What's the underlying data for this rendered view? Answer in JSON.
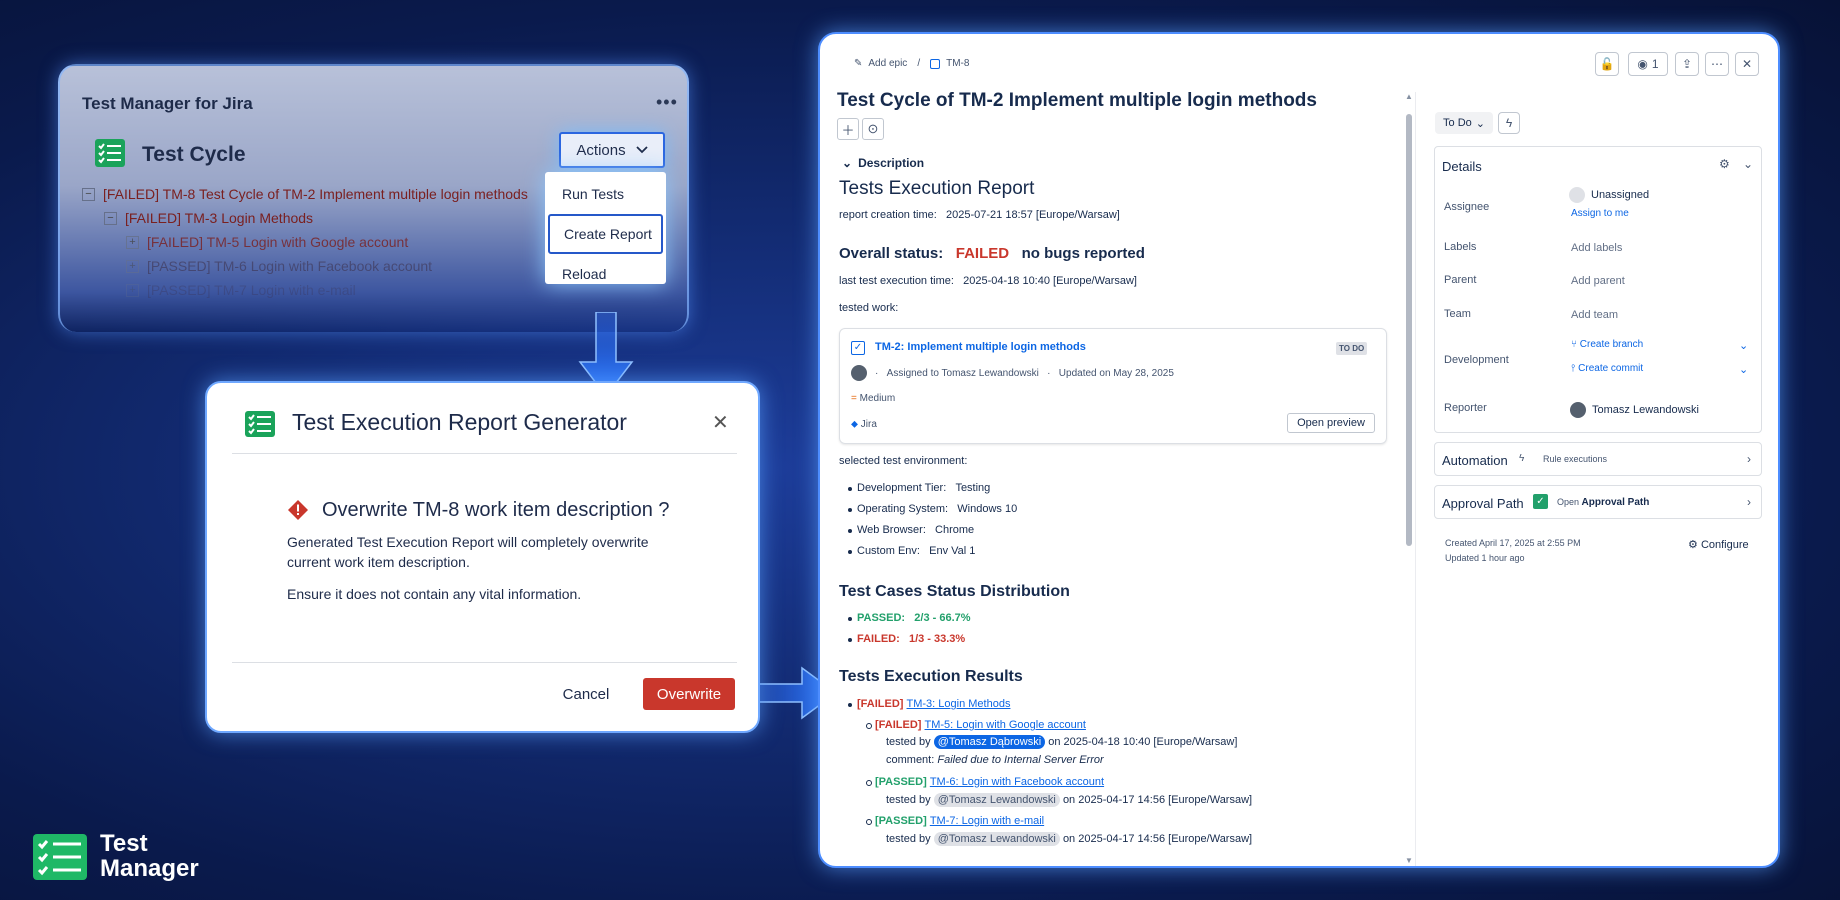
{
  "colors": {
    "accent": "#0c66e4",
    "danger": "#c9372c",
    "success": "#22a06b",
    "background": "#122a70",
    "glow": "#4d8dff"
  },
  "plugin": {
    "title": "Test Manager for Jira",
    "more_icon": "more-horizontal-icon",
    "section_title": "Test Cycle",
    "actions_label": "Actions",
    "menu": [
      "Run Tests",
      "Create Report",
      "Reload"
    ],
    "tree": [
      {
        "text": "[FAILED] TM-8 Test Cycle of TM-2 Implement multiple login methods",
        "toggle": "−"
      },
      {
        "text": "[FAILED] TM-3 Login Methods",
        "toggle": "−"
      },
      {
        "text": "[FAILED] TM-5 Login with Google account",
        "toggle": "+"
      },
      {
        "text": "[PASSED] TM-6 Login with Facebook account",
        "toggle": "+"
      },
      {
        "text": "[PASSED] TM-7 Login with e-mail",
        "toggle": "+"
      }
    ]
  },
  "dialog": {
    "title": "Test Execution Report Generator",
    "heading": "Overwrite TM-8 work item description ?",
    "body1": "Generated Test Execution Report will completely overwrite current work item description.",
    "body2": "Ensure it does not contain any vital information.",
    "cancel": "Cancel",
    "confirm": "Overwrite"
  },
  "brand": {
    "line1": "Test",
    "line2": "Manager"
  },
  "jira": {
    "breadcrumb": {
      "epic": "Add epic",
      "separator": "/",
      "key": "TM-8"
    },
    "watchers": "1",
    "title": "Test Cycle of TM-2 Implement multiple login methods",
    "description_label": "Description",
    "report": {
      "title": "Tests Execution Report",
      "creation_label": "report creation time:",
      "creation_time": "2025-07-21 18:57 [Europe/Warsaw]",
      "overall_label": "Overall status:",
      "overall_status": "FAILED",
      "bugs": "no bugs reported",
      "last_exec_label": "last test execution time:",
      "last_exec_time": "2025-04-18 10:40 [Europe/Warsaw]",
      "tested_work_label": "tested work:",
      "card": {
        "link": "TM-2: Implement multiple login methods",
        "status": "TO DO",
        "assigned": "Assigned to Tomasz Lewandowski",
        "updated": "Updated on May 28, 2025",
        "priority": "Medium",
        "source": "Jira",
        "preview": "Open preview"
      },
      "env_label": "selected test environment:",
      "env": [
        {
          "k": "Development Tier:",
          "v": "Testing"
        },
        {
          "k": "Operating System:",
          "v": "Windows 10"
        },
        {
          "k": "Web Browser:",
          "v": "Chrome"
        },
        {
          "k": "Custom Env:",
          "v": "Env Val 1"
        }
      ],
      "dist_title": "Test Cases Status Distribution",
      "dist": [
        {
          "label": "PASSED:",
          "value": "2/3 - 66.7%"
        },
        {
          "label": "FAILED:",
          "value": "1/3 - 33.3%"
        }
      ],
      "results_title": "Tests Execution Results",
      "root": {
        "status": "[FAILED]",
        "link": "TM-3: Login Methods"
      },
      "items": [
        {
          "status": "[FAILED]",
          "link": "TM-5: Login with Google account",
          "tested_by": "tested by",
          "user": "@Tomasz Dąbrowski",
          "time": "on 2025-04-18 10:40 [Europe/Warsaw]",
          "comment_label": "comment:",
          "comment": "Failed due to Internal Server Error"
        },
        {
          "status": "[PASSED]",
          "link": "TM-6: Login with Facebook account",
          "tested_by": "tested by",
          "user": "@Tomasz Lewandowski",
          "time": "on 2025-04-17 14:56 [Europe/Warsaw]"
        },
        {
          "status": "[PASSED]",
          "link": "TM-7: Login with e-mail",
          "tested_by": "tested by",
          "user": "@Tomasz Lewandowski",
          "time": "on 2025-04-17 14:56 [Europe/Warsaw]"
        }
      ]
    },
    "sidebar": {
      "status": "To Do",
      "details": "Details",
      "assignee_label": "Assignee",
      "assignee": "Unassigned",
      "assign_me": "Assign to me",
      "labels_label": "Labels",
      "labels": "Add labels",
      "parent_label": "Parent",
      "parent": "Add parent",
      "team_label": "Team",
      "team": "Add team",
      "dev_label": "Development",
      "branch": "Create branch",
      "commit": "Create commit",
      "reporter_label": "Reporter",
      "reporter": "Tomasz Lewandowski",
      "automation": "Automation",
      "rule": "Rule executions",
      "approval": "Approval Path",
      "open": "Open",
      "approval_bold": "Approval Path",
      "created": "Created April 17, 2025 at 2:55 PM",
      "updated": "Updated 1 hour ago",
      "configure": "Configure"
    }
  }
}
